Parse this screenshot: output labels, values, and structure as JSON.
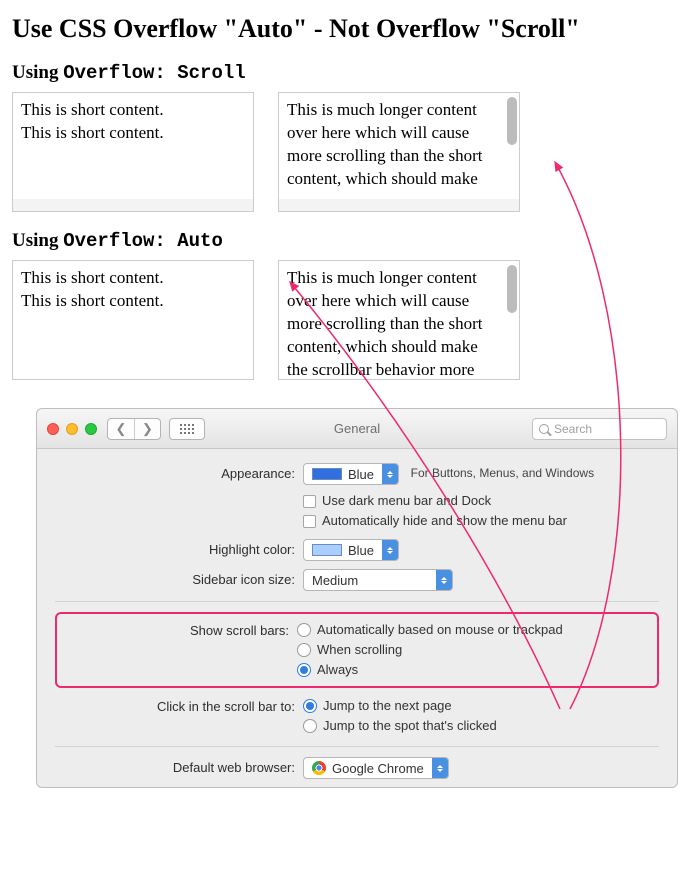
{
  "page": {
    "title": "Use CSS Overflow \"Auto\" - Not Overflow \"Scroll\""
  },
  "sections": {
    "scroll": {
      "prefix": "Using ",
      "code": "Overflow: Scroll"
    },
    "auto": {
      "prefix": "Using ",
      "code": "Overflow: Auto"
    }
  },
  "boxes": {
    "short": "This is short content.\nThis is short content.",
    "long_scroll": "This is much longer content over here which will cause more scrolling than the short content, which should make",
    "long_auto": "This is much longer content over here which will cause more scrolling than the short content, which should make the scrollbar behavior more"
  },
  "mac": {
    "window_title": "General",
    "search_placeholder": "Search",
    "appearance": {
      "label": "Appearance:",
      "value": "Blue",
      "hint": "For Buttons, Menus, and Windows",
      "dark_menu": "Use dark menu bar and Dock",
      "auto_hide_menu": "Automatically hide and show the menu bar"
    },
    "highlight": {
      "label": "Highlight color:",
      "value": "Blue"
    },
    "sidebar_size": {
      "label": "Sidebar icon size:",
      "value": "Medium"
    },
    "scrollbars": {
      "label": "Show scroll bars:",
      "opt1": "Automatically based on mouse or trackpad",
      "opt2": "When scrolling",
      "opt3": "Always"
    },
    "click_scroll": {
      "label": "Click in the scroll bar to:",
      "opt1": "Jump to the next page",
      "opt2": "Jump to the spot that's clicked"
    },
    "browser": {
      "label": "Default web browser:",
      "value": "Google Chrome"
    }
  }
}
